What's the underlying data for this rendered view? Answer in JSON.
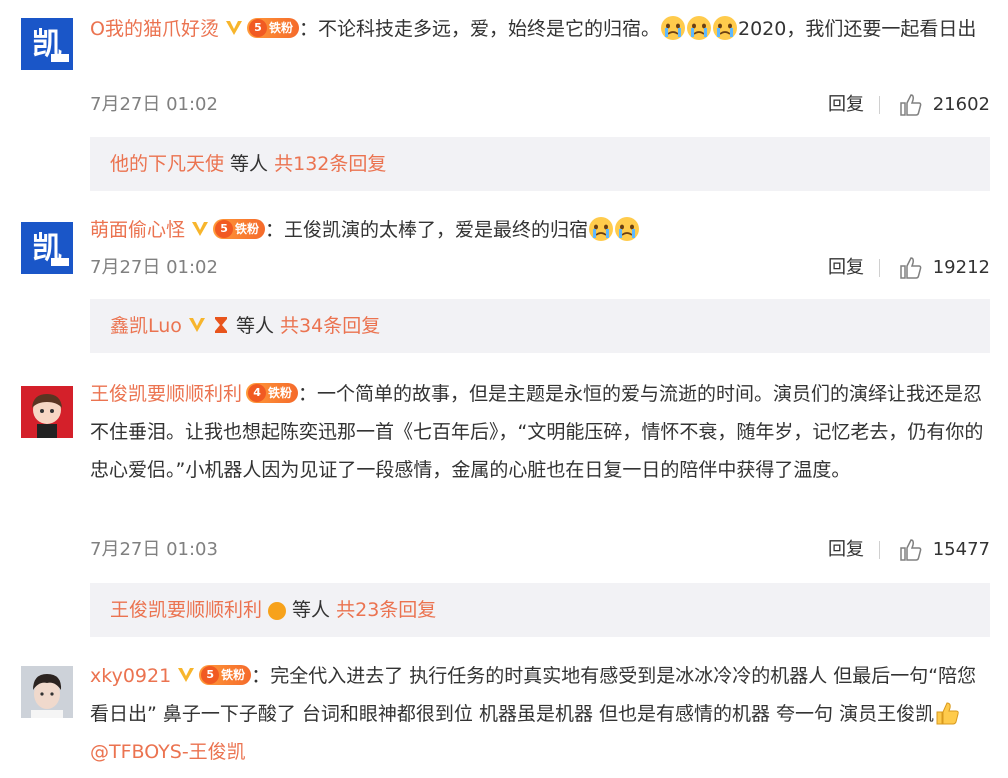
{
  "comments": [
    {
      "username": "O我的猫爪好烫",
      "fan_level": "5",
      "fan_label": "铁粉",
      "text_a": "：不论科技走多远，爱，始终是它的归宿。",
      "text_b": "2020，我们还要一起看日出",
      "emoji_count": 3,
      "time": "7月27日 01:02",
      "reply_label": "回复",
      "likes": "21602",
      "sub": {
        "names": "他的下凡天使",
        "mid": " 等人 ",
        "count_label": "共132条回复"
      }
    },
    {
      "username": "萌面偷心怪",
      "fan_level": "5",
      "fan_label": "铁粉",
      "text_a": "：王俊凯演的太棒了，爱是最终的归宿",
      "emoji_count": 2,
      "time": "7月27日 01:02",
      "reply_label": "回复",
      "likes": "19212",
      "sub": {
        "names": "鑫凯Luo",
        "mid": " 等人 ",
        "count_label": "共34条回复"
      }
    },
    {
      "username": "王俊凯要顺顺利利",
      "fan_level": "4",
      "fan_label": "铁粉",
      "text": "：一个简单的故事，但是主题是永恒的爱与流逝的时间。演员们的演绎让我还是忍不住垂泪。让我也想起陈奕迅那一首《七百年后》，“文明能压碎，情怀不衰，随年岁，记忆老去，仍有你的忠心爱侣。”小机器人因为见证了一段感情，金属的心脏也在日复一日的陪伴中获得了温度。",
      "time": "7月27日 01:03",
      "reply_label": "回复",
      "likes": "15477",
      "sub": {
        "names": "王俊凯要顺顺利利",
        "mid": " 等人 ",
        "count_label": "共23条回复"
      }
    },
    {
      "username": "xky0921",
      "fan_level": "5",
      "fan_label": "铁粉",
      "text_a": "：完全代入进去了 执行任务的时真实地有感受到是冰冰冷冷的机器人 但最后一句“陪您看日出” 鼻子一下子酸了 台词和眼神都很到位 机器虽是机器 但也是有感情的机器 夸一句 演员王俊凯",
      "mention": "@TFBOYS-王俊凯"
    }
  ],
  "colors": {
    "link": "#eb7350",
    "text": "#333333",
    "muted": "#808080",
    "sub_bg": "#f2f2f5"
  },
  "icons": [
    "verified-v-icon",
    "fan-badge-icon",
    "crying-emoji-icon",
    "thumbs-up-icon",
    "hourglass-icon",
    "thumbs-up-emoji-icon"
  ],
  "avatars": {
    "kai_text": "凯"
  }
}
